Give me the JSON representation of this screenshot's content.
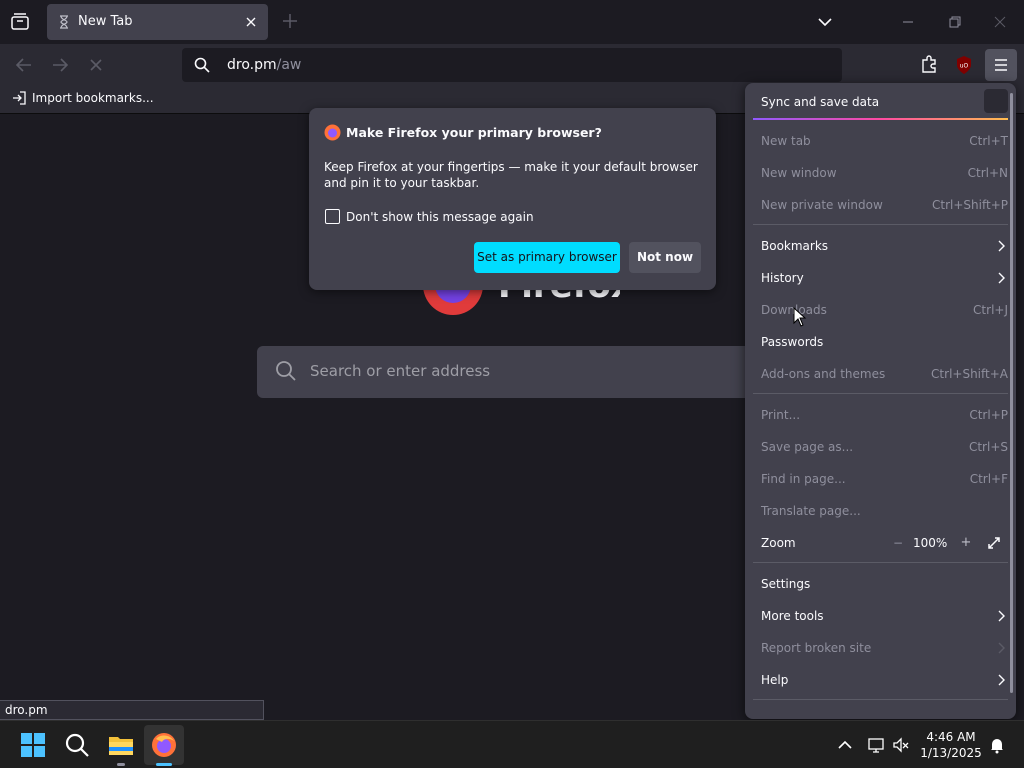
{
  "tab": {
    "title": "New Tab"
  },
  "urlbar": {
    "host": "dro.pm",
    "path": "/aw"
  },
  "bookmarks": {
    "import_label": "Import bookmarks..."
  },
  "newtab": {
    "search_placeholder": "Search or enter address",
    "logo_text": "Firefox"
  },
  "popup": {
    "title": "Make Firefox your primary browser?",
    "body": "Keep Firefox at your fingertips — make it your default browser and pin it to your taskbar.",
    "checkbox_label": "Don't show this message again",
    "primary_button": "Set as primary browser",
    "secondary_button": "Not now"
  },
  "appmenu": {
    "sync_label": "Sync and save data",
    "new_tab": {
      "label": "New tab",
      "shortcut": "Ctrl+T"
    },
    "new_window": {
      "label": "New window",
      "shortcut": "Ctrl+N"
    },
    "new_private_window": {
      "label": "New private window",
      "shortcut": "Ctrl+Shift+P"
    },
    "bookmarks": {
      "label": "Bookmarks"
    },
    "history": {
      "label": "History"
    },
    "downloads": {
      "label": "Downloads",
      "shortcut": "Ctrl+J"
    },
    "passwords": {
      "label": "Passwords"
    },
    "addons": {
      "label": "Add-ons and themes",
      "shortcut": "Ctrl+Shift+A"
    },
    "print": {
      "label": "Print...",
      "shortcut": "Ctrl+P"
    },
    "save_page": {
      "label": "Save page as...",
      "shortcut": "Ctrl+S"
    },
    "find": {
      "label": "Find in page...",
      "shortcut": "Ctrl+F"
    },
    "translate": {
      "label": "Translate page..."
    },
    "zoom": {
      "label": "Zoom",
      "value": "100%",
      "minus": "−",
      "plus": "+"
    },
    "settings": {
      "label": "Settings"
    },
    "more_tools": {
      "label": "More tools"
    },
    "report_broken": {
      "label": "Report broken site"
    },
    "help": {
      "label": "Help"
    }
  },
  "statusbar": {
    "link": "dro.pm"
  },
  "taskbar": {
    "time": "4:46 AM",
    "date": "1/13/2025"
  },
  "colors": {
    "accent": "#00ddff",
    "toolbar": "#2b2a33",
    "panel": "#42414d",
    "background": "#1c1b22"
  }
}
